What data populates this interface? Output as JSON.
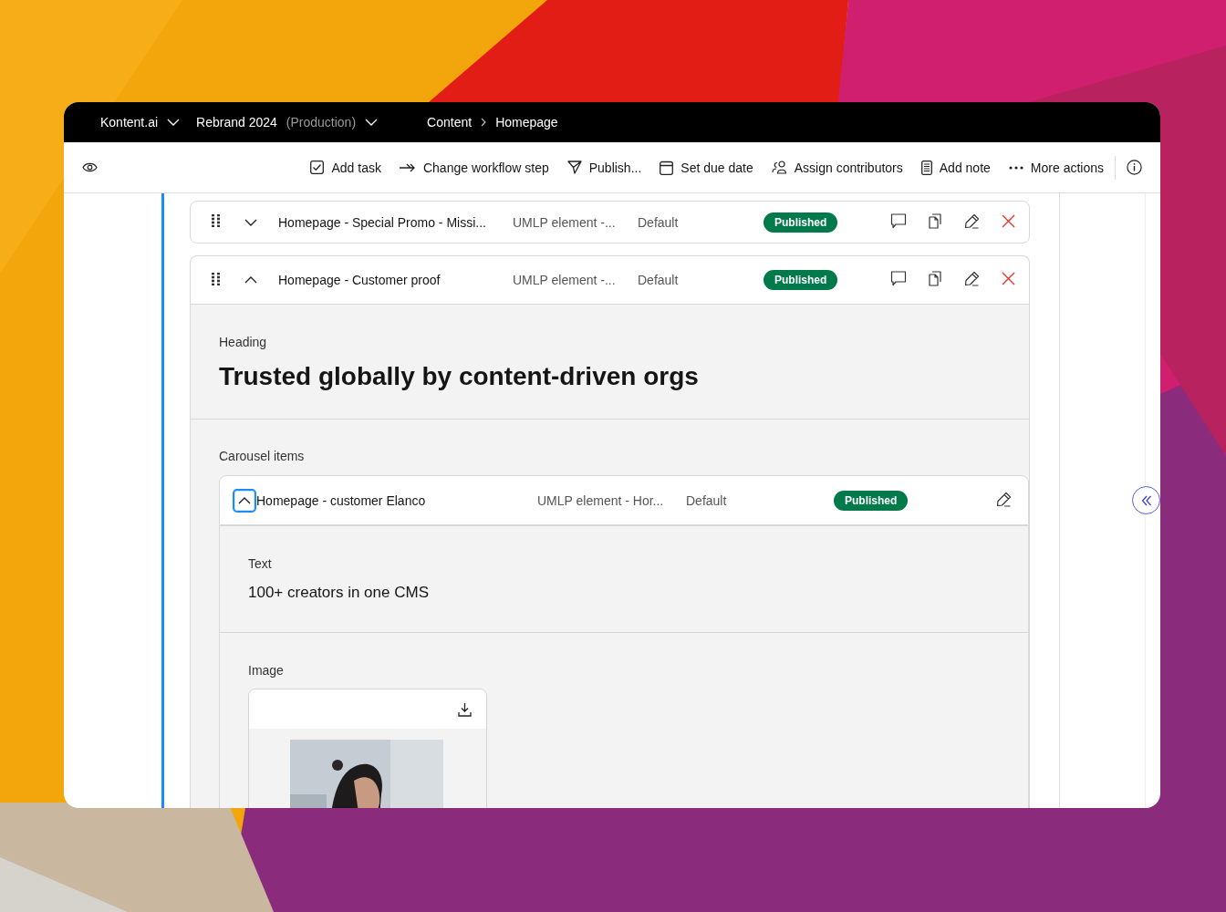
{
  "topbar": {
    "project": "Kontent.ai",
    "environment": "Rebrand 2024",
    "environment_note": "(Production)",
    "breadcrumbs": [
      "Content",
      "Homepage"
    ]
  },
  "toolbar": {
    "actions": [
      {
        "label": "Add task",
        "kind": "task"
      },
      {
        "label": "Change workflow step",
        "kind": "workflow"
      },
      {
        "label": "Publish...",
        "kind": "publish"
      },
      {
        "label": "Set due date",
        "kind": "date"
      },
      {
        "label": "Assign contributors",
        "kind": "contributors"
      },
      {
        "label": "Add note",
        "kind": "note"
      },
      {
        "label": "More actions",
        "kind": "more"
      }
    ]
  },
  "items": [
    {
      "name": "Homepage - Special Promo - Missi...",
      "type": "UMLP element -...",
      "collection": "Default",
      "status": "Published",
      "expanded": false
    },
    {
      "name": "Homepage - Customer proof",
      "type": "UMLP element -...",
      "collection": "Default",
      "status": "Published",
      "expanded": true,
      "heading_label": "Heading",
      "heading": "Trusted globally by content-driven orgs",
      "carousel_label": "Carousel items",
      "carousel": [
        {
          "name": "Homepage - customer Elanco",
          "type": "UMLP element - Hor...",
          "collection": "Default",
          "status": "Published",
          "expanded": true,
          "focused": true,
          "text_label": "Text",
          "text": "100+ creators in one CMS",
          "image_label": "Image"
        }
      ]
    }
  ]
}
